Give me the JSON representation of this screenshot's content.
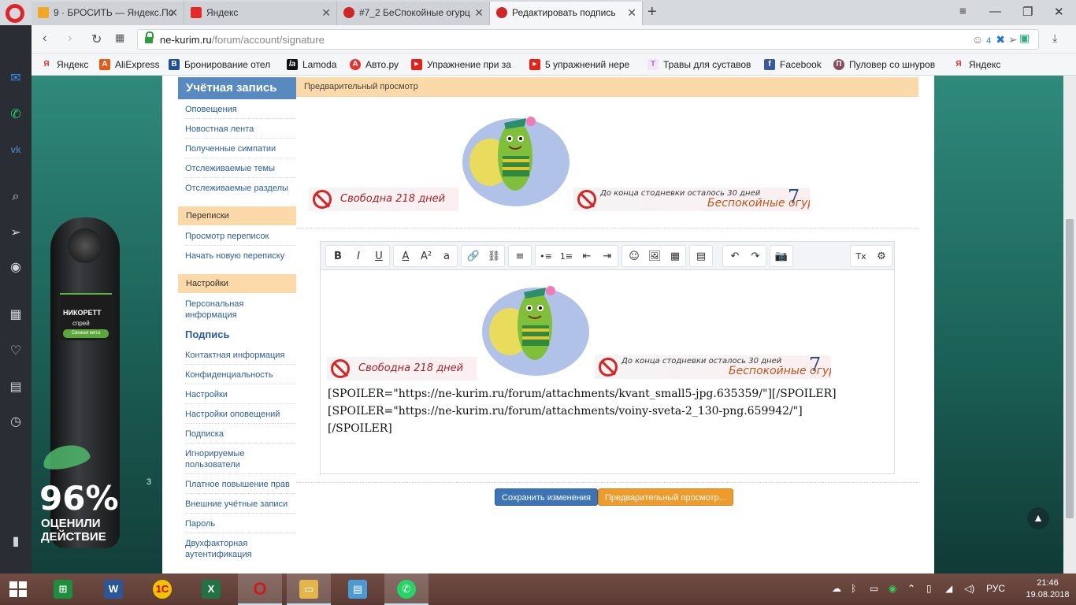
{
  "browser": {
    "tabs": [
      {
        "label": "9 · БРОСИТЬ — Яндекс.По",
        "color": "#f5a623"
      },
      {
        "label": "Яндекс",
        "color": "#e62a2a"
      },
      {
        "label": "#7_2 БеСпокойные огурц",
        "color": "#d02525"
      },
      {
        "label": "Редактировать подпись",
        "color": "#d02525"
      }
    ],
    "new_tab": "+",
    "url_host": "ne-kurim.ru",
    "url_path": "/forum/account/signature",
    "url_badge": "4",
    "bookmarks": [
      {
        "label": "Яндекс",
        "icon": "Я",
        "color": "#e62a2a"
      },
      {
        "label": "AliExpress",
        "icon": "A",
        "color": "#e55a16"
      },
      {
        "label": "Бронирование отел",
        "icon": "B",
        "color": "#1d4f9c"
      },
      {
        "label": "Lamoda",
        "icon": "la",
        "color": "#111111"
      },
      {
        "label": "Авто.ру",
        "icon": "A",
        "color": "#e2322b"
      },
      {
        "label": "Упражнение при за",
        "icon": "▶",
        "color": "#e62117"
      },
      {
        "label": "5 упражнений нере",
        "icon": "▶",
        "color": "#e62117"
      },
      {
        "label": "Травы для суставов",
        "icon": "Т",
        "color": "#b06ad0"
      },
      {
        "label": "Facebook",
        "icon": "f",
        "color": "#3b5998"
      },
      {
        "label": "Пуловер со шнуров",
        "icon": "П",
        "color": "#8a4b5b"
      },
      {
        "label": "Яндекс",
        "icon": "Я",
        "color": "#e62a2a"
      }
    ]
  },
  "ad": {
    "brand": "НИКОРЕТТ",
    "sub": "спрей",
    "tag": "Свежая мята",
    "percent": "96%",
    "sup": "3",
    "caption_line1": "ОЦЕНИЛИ",
    "caption_line2": "ДЕЙСТВИЕ"
  },
  "account": {
    "title": "Учётная запись",
    "links_main": [
      "Оповещения",
      "Новостная лента",
      "Полученные симпатии",
      "Отслеживаемые темы",
      "Отслеживаемые разделы"
    ],
    "group_conversations": "Переписки",
    "links_conversations": [
      "Просмотр переписок",
      "Начать новую переписку"
    ],
    "group_settings": "Настройки",
    "link_personal": "Персональная информация",
    "current": "Подпись",
    "links_settings": [
      "Контактная информация",
      "Конфиденциальность",
      "Настройки",
      "Настройки оповещений",
      "Подписка",
      "Игнорируемые пользователи",
      "Платное повышение прав",
      "Внешние учётные записи",
      "Пароль",
      "Двухфакторная аутентификация"
    ]
  },
  "preview": {
    "header": "Предварительный просмотр"
  },
  "signature": {
    "banner_left": "Свободна 218 дней",
    "banner_right_top": "До конца стодневки осталось 30 дней",
    "banner_right_bottom": "Беспокойные огур",
    "banner_right_num": "7",
    "pic_text": "Беспокойные огурцы"
  },
  "editor": {
    "toolbar": [
      "B",
      "I",
      "U",
      "A",
      "A²",
      "a",
      "🔗",
      "⛓",
      "≡",
      "•≡",
      "1≡",
      "⇤",
      "⇥",
      "☺",
      "🖼",
      "▦",
      "▤",
      "↶",
      "↷",
      "📷",
      "Tx",
      "⚙"
    ],
    "lines": [
      "[SPOILER=\"https://ne-kurim.ru/forum/attachments/kvant_small5-jpg.635359/\"][/SPOILER]",
      "[SPOILER=\"https://ne-kurim.ru/forum/attachments/voiny-sveta-2_130-png.659942/\"]",
      "[/SPOILER]"
    ]
  },
  "buttons": {
    "save": "Сохранить изменения",
    "preview": "Предварительный просмотр..."
  },
  "taskbar": {
    "apps": [
      {
        "name": "excel-green",
        "label": "⊞",
        "color": "#1e8e3e"
      },
      {
        "name": "word",
        "label": "W",
        "color": "#2b579a"
      },
      {
        "name": "1c",
        "label": "1С",
        "color": "#f2c200"
      },
      {
        "name": "excel",
        "label": "X",
        "color": "#217346"
      },
      {
        "name": "opera",
        "label": "O",
        "color": "#cc1b23"
      },
      {
        "name": "explorer",
        "label": "▭",
        "color": "#e3b54a"
      },
      {
        "name": "paint",
        "label": "▤",
        "color": "#4a9ad4"
      },
      {
        "name": "whatsapp",
        "label": "✆",
        "color": "#25d366"
      }
    ],
    "lang": "РУС",
    "time": "21:46",
    "date": "19.08.2018"
  }
}
